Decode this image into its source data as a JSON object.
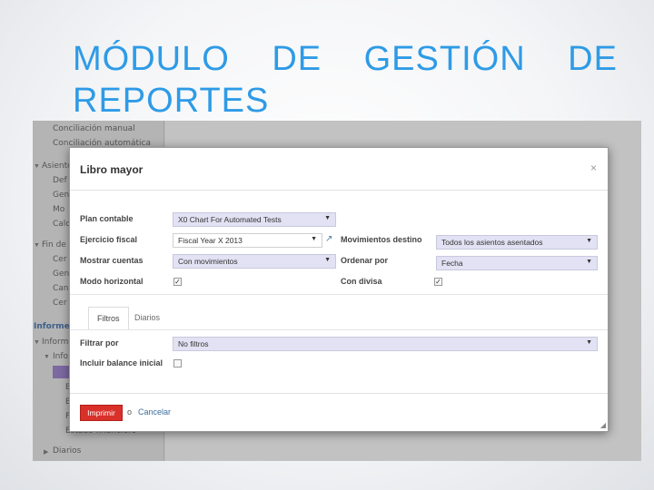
{
  "slide": {
    "title_line1": [
      "MÓDULO",
      "DE",
      "GESTIÓN",
      "DE"
    ],
    "title_line2": "REPORTES"
  },
  "sidebar": {
    "items": [
      {
        "label": "Conciliación manual"
      },
      {
        "label": "Conciliación automática"
      },
      {
        "label": "Asientos"
      },
      {
        "label": "Def"
      },
      {
        "label": "Gen"
      },
      {
        "label": "Mo"
      },
      {
        "label": "Calc"
      },
      {
        "label": "Fin de p"
      },
      {
        "label": "Cer"
      },
      {
        "label": "Gen"
      },
      {
        "label": "Can"
      },
      {
        "label": "Cer"
      },
      {
        "label": "Informe"
      },
      {
        "label": "Informe"
      },
      {
        "label": "Info"
      },
      {
        "label": "B"
      },
      {
        "label": "B"
      },
      {
        "label": "Fl"
      },
      {
        "label": "Estado financiero"
      },
      {
        "label": "Diarios"
      }
    ]
  },
  "modal": {
    "title": "Libro mayor",
    "close_icon": "close-icon",
    "fields": {
      "plan_contable": {
        "label": "Plan contable",
        "value": "X0 Chart For Automated Tests"
      },
      "ejercicio_fiscal": {
        "label": "Ejercicio fiscal",
        "value": "Fiscal Year X 2013"
      },
      "mostrar_cuentas": {
        "label": "Mostrar cuentas",
        "value": "Con movimientos"
      },
      "modo_horizontal": {
        "label": "Modo horizontal",
        "checked": true
      },
      "movimientos_destino": {
        "label": "Movimientos destino",
        "value": "Todos los asientos asentados"
      },
      "ordenar_por": {
        "label": "Ordenar por",
        "value": "Fecha"
      },
      "con_divisa": {
        "label": "Con divisa",
        "checked": true
      }
    },
    "tabs": [
      {
        "label": "Filtros",
        "active": true
      },
      {
        "label": "Diarios",
        "active": false
      }
    ],
    "filters": {
      "filtrar_por": {
        "label": "Filtrar por",
        "value": "No filtros"
      },
      "incluir_balance": {
        "label": "Incluir balance inicial",
        "checked": false
      }
    },
    "footer": {
      "print_label": "Imprimir",
      "or_label": "o",
      "cancel_label": "Cancelar"
    }
  },
  "colors": {
    "title": "#2e9be6",
    "print_button": "#d9302a",
    "select_bg": "#e2e2f4"
  }
}
